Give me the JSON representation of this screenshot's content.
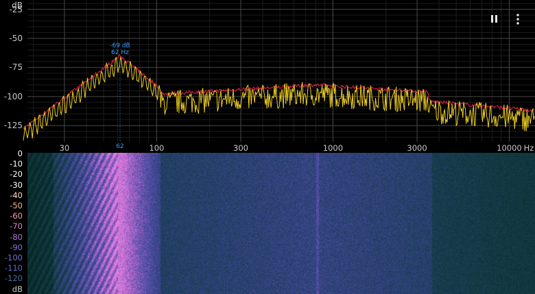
{
  "spectrum": {
    "y_unit": "dB",
    "x_unit": "Hz",
    "y_ticks": [
      "-25",
      "-50",
      "-75",
      "-100",
      "-125"
    ],
    "y_tick_values": [
      -25,
      -50,
      -75,
      -100,
      -125
    ],
    "x_ticks": [
      "30",
      "100",
      "300",
      "1000",
      "3000",
      "10000"
    ],
    "x_tick_values": [
      30,
      100,
      300,
      1000,
      3000,
      10000
    ],
    "y_range": [
      -17,
      -139
    ],
    "x_range_hz": [
      18.5,
      14000
    ],
    "peak": {
      "db_label": "-69 dB",
      "hz_label": "62 Hz",
      "marker_label": "62",
      "freq_hz": 62,
      "db": -69
    },
    "colors": {
      "background": "#000000",
      "live_trace": "#f0d020",
      "peak_hold_trace": "#e8204a",
      "grid": "#2e2e2e",
      "peak_label": "#3aa0ff",
      "axis_label": "#c8c8c8"
    }
  },
  "toolbar": {
    "pause_icon": "pause-icon",
    "menu_icon": "more-vert-icon"
  },
  "spectrogram": {
    "y_unit": "dB",
    "legend": [
      {
        "label": "0",
        "color": "#ffffff"
      },
      {
        "label": "-10",
        "color": "#ffffff"
      },
      {
        "label": "-20",
        "color": "#ffffff"
      },
      {
        "label": "-30",
        "color": "#ffffff"
      },
      {
        "label": "-40",
        "color": "#ffd9c0"
      },
      {
        "label": "-50",
        "color": "#ffb08a"
      },
      {
        "label": "-60",
        "color": "#f59ab0"
      },
      {
        "label": "-70",
        "color": "#e080d0"
      },
      {
        "label": "-80",
        "color": "#b078e0"
      },
      {
        "label": "-90",
        "color": "#8a70e0"
      },
      {
        "label": "-100",
        "color": "#6f72d8"
      },
      {
        "label": "-110",
        "color": "#5a6ec8"
      },
      {
        "label": "-120",
        "color": "#4a70a8"
      }
    ],
    "colors": {
      "low": "#0b2a2a",
      "mid": "#2a3a7a",
      "high": "#b070d0",
      "hot": "#e080e0"
    }
  }
}
